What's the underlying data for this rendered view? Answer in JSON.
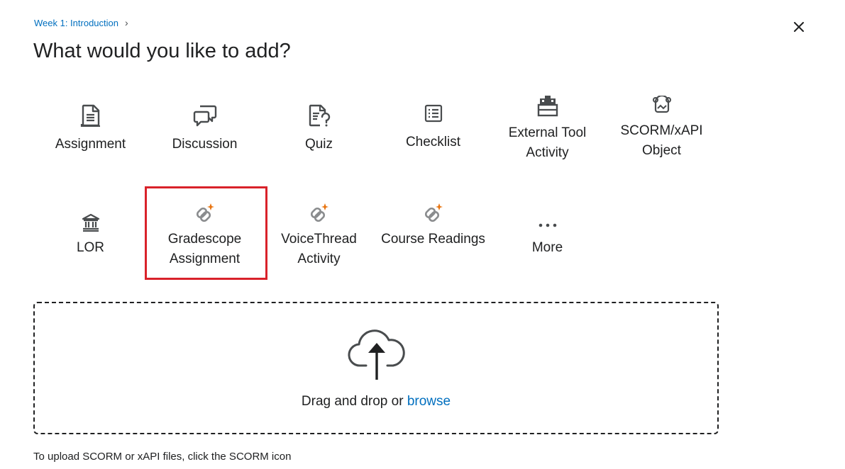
{
  "breadcrumb": {
    "parent": "Week 1: Introduction",
    "separator": "›"
  },
  "dialog": {
    "title": "What would you like to add?",
    "close_icon": "close-icon"
  },
  "tiles_row1": [
    {
      "label": "Assignment",
      "icon": "assignment-icon"
    },
    {
      "label": "Discussion",
      "icon": "discussion-icon"
    },
    {
      "label": "Quiz",
      "icon": "quiz-icon"
    },
    {
      "label": "Checklist",
      "icon": "checklist-icon"
    },
    {
      "label": "External Tool Activity",
      "icon": "external-tool-icon"
    },
    {
      "label": "SCORM/xAPI Object",
      "icon": "scorm-icon"
    }
  ],
  "tiles_row2": [
    {
      "label": "LOR",
      "icon": "lor-icon"
    },
    {
      "label": "Gradescope Assignment",
      "icon": "lti-link-icon",
      "highlighted": true
    },
    {
      "label": "VoiceThread Activity",
      "icon": "lti-link-icon"
    },
    {
      "label": "Course Readings",
      "icon": "lti-link-icon"
    },
    {
      "label": "More",
      "icon": "more-icon"
    }
  ],
  "upload": {
    "text": "Drag and drop or ",
    "browse_label": "browse",
    "icon": "cloud-upload-icon"
  },
  "footnote": "To upload SCORM or xAPI files, click the SCORM icon",
  "colors": {
    "link": "#006fbf",
    "highlight": "#d9222a",
    "accent_spark": "#e87511",
    "text": "#202122"
  }
}
